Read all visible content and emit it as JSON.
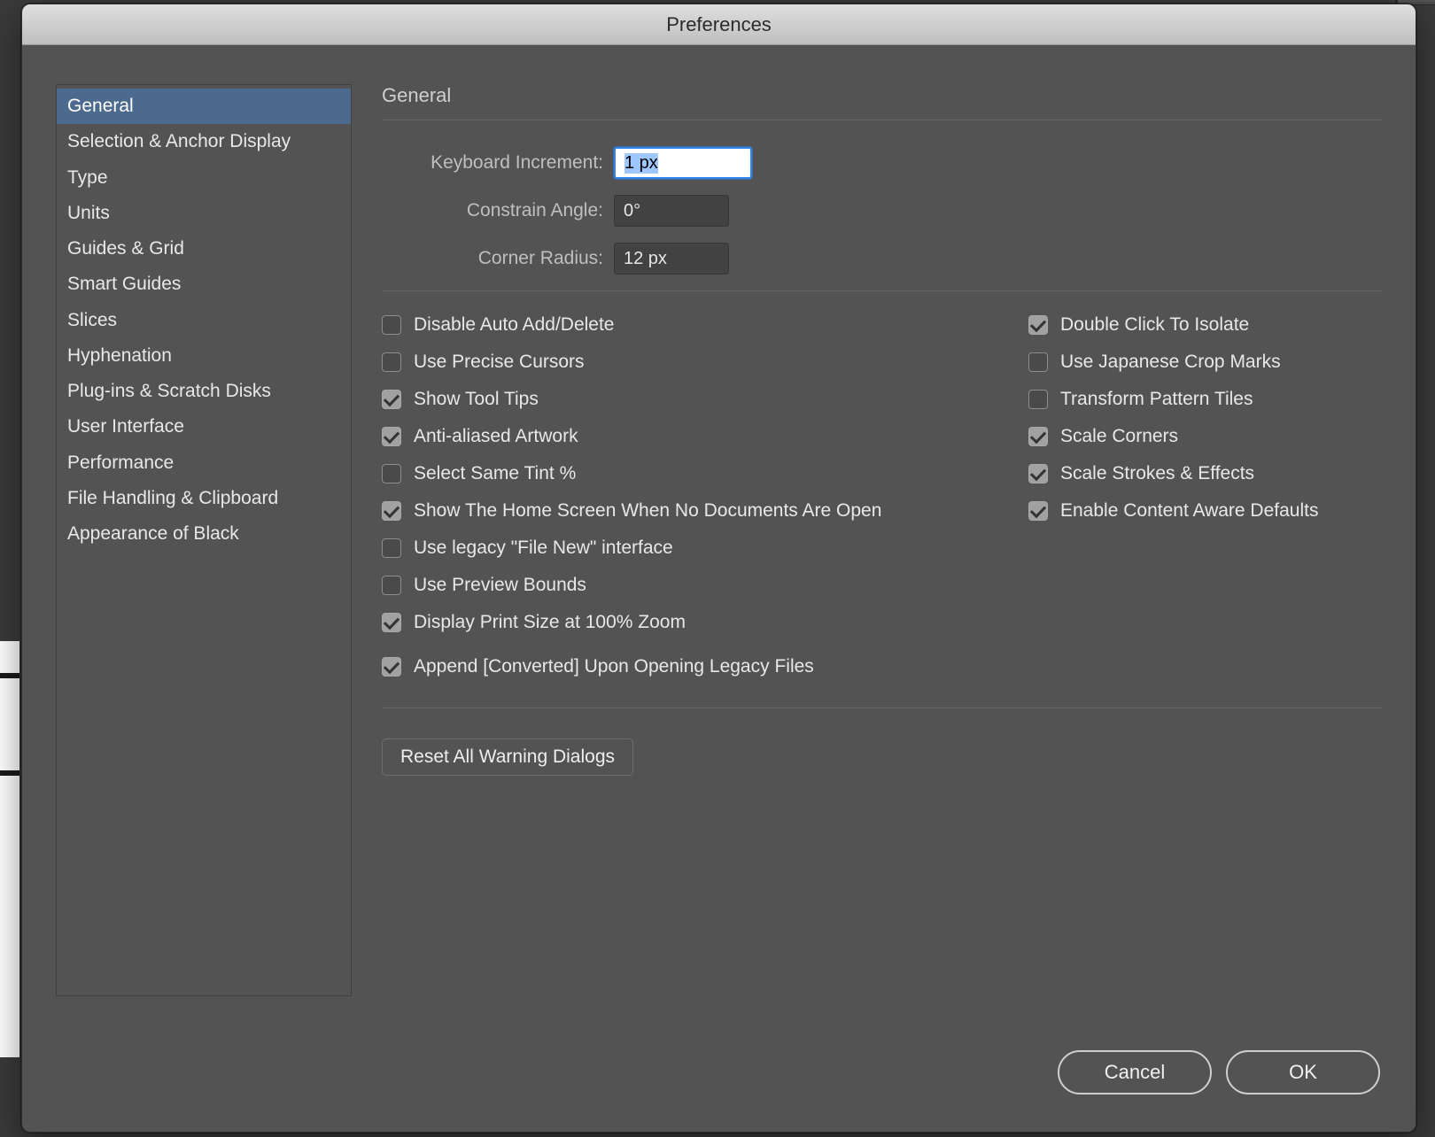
{
  "dialog": {
    "title": "Preferences"
  },
  "sidebar": {
    "items": [
      "General",
      "Selection & Anchor Display",
      "Type",
      "Units",
      "Guides & Grid",
      "Smart Guides",
      "Slices",
      "Hyphenation",
      "Plug-ins & Scratch Disks",
      "User Interface",
      "Performance",
      "File Handling & Clipboard",
      "Appearance of Black"
    ],
    "selected_index": 0
  },
  "panel": {
    "title": "General",
    "fields": {
      "keyboard_increment": {
        "label": "Keyboard Increment:",
        "value": "1 px"
      },
      "constrain_angle": {
        "label": "Constrain Angle:",
        "value": "0°"
      },
      "corner_radius": {
        "label": "Corner Radius:",
        "value": "12 px"
      }
    },
    "checks_left": [
      {
        "label": "Disable Auto Add/Delete",
        "checked": false
      },
      {
        "label": "Use Precise Cursors",
        "checked": false
      },
      {
        "label": "Show Tool Tips",
        "checked": true
      },
      {
        "label": "Anti-aliased Artwork",
        "checked": true
      },
      {
        "label": "Select Same Tint %",
        "checked": false
      },
      {
        "label": "Show The Home Screen When No Documents Are Open",
        "checked": true
      },
      {
        "label": "Use legacy \"File New\" interface",
        "checked": false
      },
      {
        "label": "Use Preview Bounds",
        "checked": false
      },
      {
        "label": "Display Print Size at 100% Zoom",
        "checked": true
      },
      {
        "label": "Append [Converted] Upon Opening Legacy Files",
        "checked": true
      }
    ],
    "checks_right": [
      {
        "label": "Double Click To Isolate",
        "checked": true
      },
      {
        "label": "Use Japanese Crop Marks",
        "checked": false
      },
      {
        "label": "Transform Pattern Tiles",
        "checked": false
      },
      {
        "label": "Scale Corners",
        "checked": true
      },
      {
        "label": "Scale Strokes & Effects",
        "checked": true
      },
      {
        "label": "Enable Content Aware Defaults",
        "checked": true
      }
    ],
    "reset_button": "Reset All Warning Dialogs"
  },
  "footer": {
    "cancel": "Cancel",
    "ok": "OK"
  }
}
